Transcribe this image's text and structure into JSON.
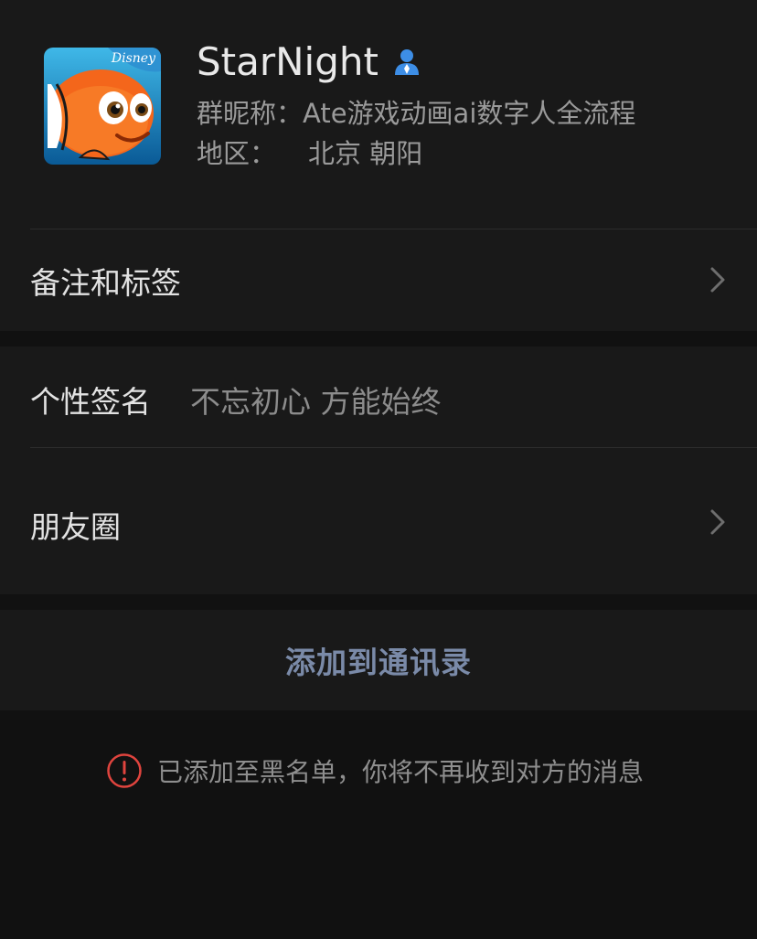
{
  "profile": {
    "nickname": "StarNight",
    "avatar": "clownfish-cartoon-avatar",
    "avatar_badge": "Disney",
    "gender_icon": "male-icon",
    "group_nickname_label": "群昵称：",
    "group_nickname_value": "Ate游戏动画ai数字人全流程",
    "region_label": "地区：",
    "region_value": "北京 朝阳"
  },
  "rows": {
    "remarks_label": "备注和标签",
    "signature_label": "个性签名",
    "signature_value": "不忘初心 方能始终",
    "moments_label": "朋友圈"
  },
  "actions": {
    "add_contact_label": "添加到通讯录"
  },
  "notice": {
    "icon": "exclamation-circle-icon",
    "text": "已添加至黑名单，你将不再收到对方的消息"
  },
  "colors": {
    "background": "#111111",
    "card": "#191919",
    "link_blue": "#7a8aa8",
    "warning_red": "#e0443e",
    "gender_blue": "#3d8ee6"
  }
}
